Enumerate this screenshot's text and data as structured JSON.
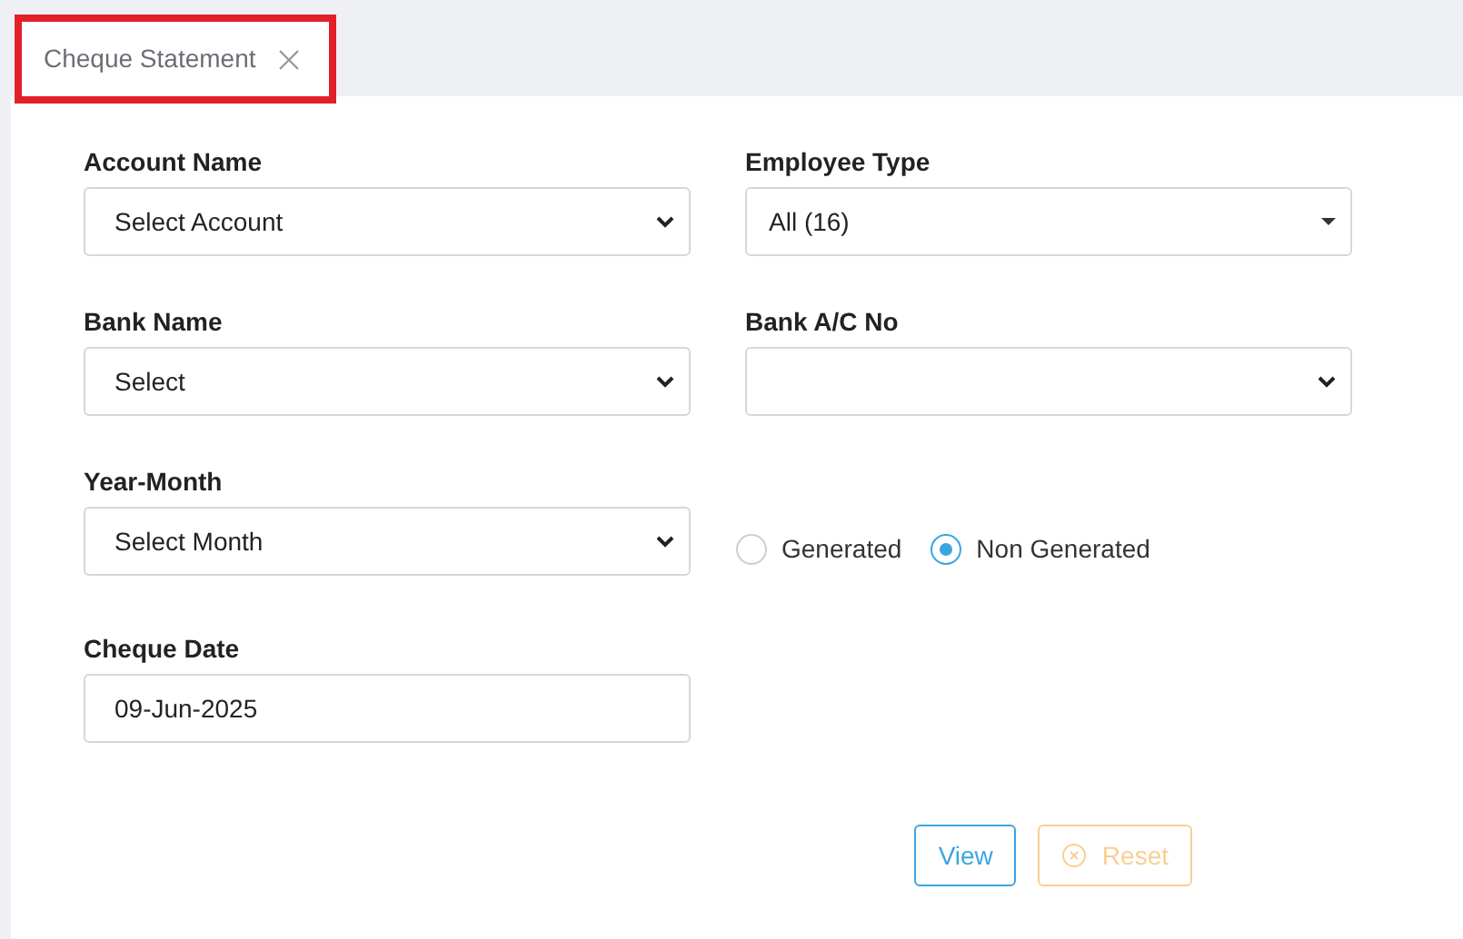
{
  "tabs": [
    {
      "label": "Cheque Statement",
      "selected": true,
      "highlighted": true
    }
  ],
  "fields": [
    {
      "label": "Account Name",
      "kind": "select",
      "value": "Select Account"
    },
    {
      "label": "Employee Type",
      "kind": "dropdown",
      "value": "All (16)"
    },
    {
      "label": "Bank Name",
      "kind": "select",
      "value": "Select"
    },
    {
      "label": "Bank A/C No",
      "kind": "select"
    },
    {
      "label": "Year-Month",
      "kind": "select",
      "value": "Select Month"
    },
    {
      "kind": "radios",
      "options": [
        {
          "label": "Generated",
          "selected": false
        },
        {
          "label": "Non Generated",
          "selected": true
        }
      ]
    },
    {
      "label": "Cheque Date",
      "kind": "input",
      "value": "09-Jun-2025"
    }
  ],
  "buttons": [
    {
      "label": "View",
      "kind": "view",
      "disabled": false
    },
    {
      "label": "Reset",
      "kind": "reset",
      "disabled": true
    }
  ]
}
